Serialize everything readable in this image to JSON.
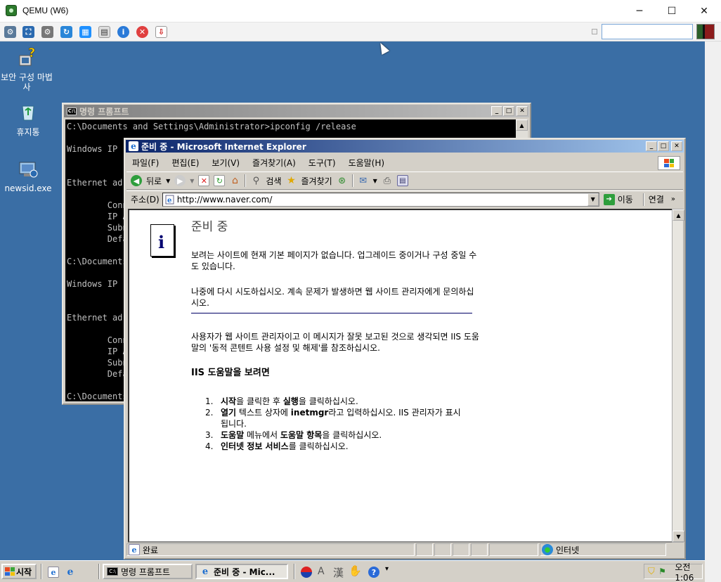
{
  "host": {
    "title": "QEMU (W6)",
    "minimize": "─",
    "maximize": "☐",
    "close": "✕"
  },
  "desktop": {
    "icons": [
      {
        "label": "보안 구성 마법사",
        "icon": "security-wizard-icon"
      },
      {
        "label": "휴지통",
        "icon": "recycle-bin-icon"
      },
      {
        "label": "newsid.exe",
        "icon": "newsid-icon"
      }
    ]
  },
  "cmd": {
    "title": "명령 프롬프트",
    "lines": [
      "C:\\Documents and Settings\\Administrator>ipconfig /release",
      "",
      "Windows IP",
      "",
      "",
      "Ethernet ad",
      "",
      "        Connect",
      "        IP Addre",
      "        Subnet M",
      "        Default",
      "",
      "C:\\Documents",
      "",
      "Windows IP",
      "",
      "",
      "Ethernet ad",
      "",
      "        Connect",
      "        IP Addre",
      "        Subnet M",
      "        Default",
      "",
      "C:\\Documents"
    ]
  },
  "ie": {
    "title": "준비 중 - Microsoft Internet Explorer",
    "menu": [
      "파일(F)",
      "편집(E)",
      "보기(V)",
      "즐겨찾기(A)",
      "도구(T)",
      "도움말(H)"
    ],
    "toolbar": {
      "back": "뒤로",
      "search": "검색",
      "favorites": "즐겨찾기"
    },
    "address_label": "주소(D)",
    "address_value": "http://www.naver.com/",
    "go_label": "이동",
    "links_label": "연결",
    "status_text": "완료",
    "zone_text": "인터넷",
    "page": {
      "heading": "준비 중",
      "para1": "보려는 사이트에 현재 기본 페이지가 없습니다. 업그레이드 중이거나 구성 중일 수도 있습니다.",
      "para2": "나중에 다시 시도하십시오. 계속 문제가 발생하면 웹 사이트 관리자에게 문의하십시오.",
      "para3": "사용자가 웹 사이트 관리자이고 이 메시지가 잘못 보고된 것으로 생각되면 IIS 도움말의 '동적 콘텐트 사용 설정 및 해제'를 참조하십시오.",
      "subheading": "IIS 도움말을 보려면",
      "steps": [
        {
          "num": "1.",
          "html": "<b>시작</b>을 클릭한 후 <b>실행</b>을 클릭하십시오."
        },
        {
          "num": "2.",
          "html": "<b>열기</b> 텍스트 상자에 <b>inetmgr</b>라고 입력하십시오. IIS 관리자가 표시됩니다."
        },
        {
          "num": "3.",
          "html": "<b>도움말</b> 메뉴에서 <b>도움말 항목</b>을 클릭하십시오."
        },
        {
          "num": "4.",
          "html": "<b>인터넷 정보 서비스</b>를 클릭하십시오."
        }
      ]
    }
  },
  "taskbar": {
    "start": "시작",
    "tasks": [
      "명령 프롬프트",
      "준비 중 - Mic..."
    ],
    "ime_a": "A",
    "ime_han": "漢",
    "clock": "오전 1:06"
  }
}
